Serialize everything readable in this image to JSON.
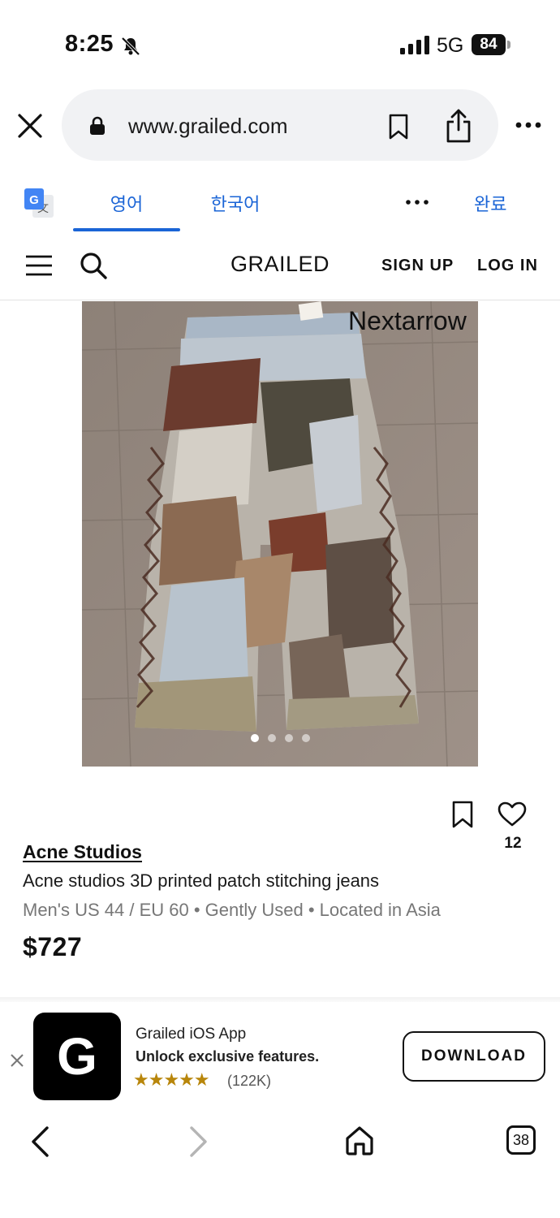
{
  "status_bar": {
    "time": "8:25",
    "network": "5G",
    "battery": "84"
  },
  "browser": {
    "url": "www.grailed.com"
  },
  "translate_bar": {
    "tab_source": "영어",
    "tab_target": "한국어",
    "done": "완료"
  },
  "site_header": {
    "logo": "GRAILED",
    "signup": "SIGN UP",
    "login": "LOG IN"
  },
  "product": {
    "image_watermark": "Nextarrow",
    "image_count": 4,
    "active_image": 1,
    "brand": "Acne Studios",
    "title": "Acne studios 3D printed patch stitching jeans",
    "meta": "Men's US 44 / EU 60 • Gently Used • Located in Asia",
    "price": "$727",
    "likes": "12"
  },
  "app_banner": {
    "app_name": "Grailed iOS App",
    "description": "Unlock exclusive features.",
    "stars": "★★★★★",
    "rating_value": 5,
    "rating_count": "(122K)",
    "icon_letter": "G",
    "download_label": "DOWNLOAD"
  },
  "toolbar": {
    "tab_count": "38"
  },
  "colors": {
    "accent_blue": "#1a64d6",
    "star_gold": "#b8860b"
  }
}
